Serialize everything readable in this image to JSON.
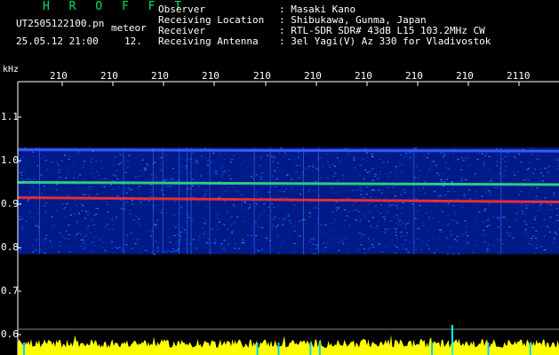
{
  "header": {
    "brand": "H R O F F T",
    "filename": "UT2505122100.pn",
    "filename_suffix": "meteor",
    "datetime": "25.05.12 21:00",
    "count": "12.",
    "info": [
      {
        "key": "Observer",
        "value": ": Masaki Kano"
      },
      {
        "key": "Receiving Location",
        "value": ": Shibukawa, Gunma, Japan"
      },
      {
        "key": "Receiver",
        "value": ": RTL-SDR SDR# 43dB L15 103.2MHz CW"
      },
      {
        "key": "Receiving Antenna",
        "value": ": 3el Yagi(V) Az 330 for Vladivostok"
      }
    ]
  },
  "chart_data": {
    "type": "heatmap",
    "ylabel": "kHz",
    "y_ticks": [
      "1.1",
      "1.0",
      "0.9",
      "0.8",
      "0.7",
      "0.6"
    ],
    "y_range": [
      0.6,
      1.15
    ],
    "x_ticks": [
      "210",
      "210",
      "210",
      "210",
      "210",
      "210",
      "210",
      "210",
      "210",
      "2110"
    ],
    "noise_band": [
      0.785,
      1.03
    ],
    "signal_lines": [
      {
        "freq_start": 0.915,
        "freq_end": 0.905,
        "color": "#ff3030"
      },
      {
        "freq_start": 0.95,
        "freq_end": 0.945,
        "color": "#30e080"
      },
      {
        "freq_start": 1.025,
        "freq_end": 1.022,
        "color": "#4060ff"
      }
    ],
    "signal_trace_color": "#ffff00",
    "background_color": "#000000"
  }
}
